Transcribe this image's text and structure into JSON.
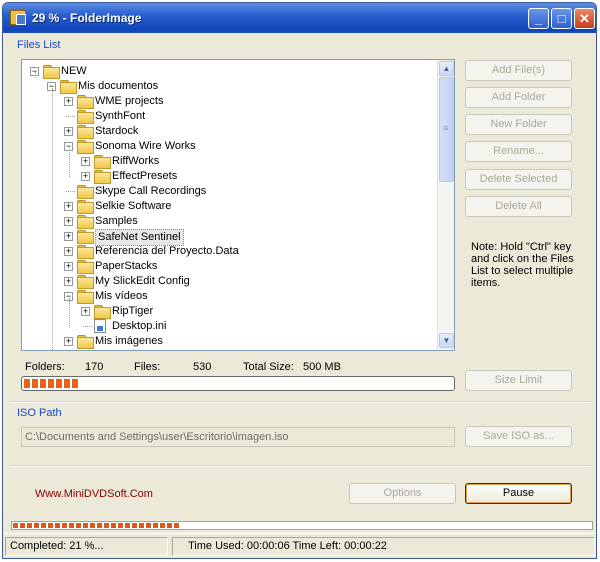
{
  "window": {
    "title": "29 % - FolderImage",
    "min_icon": "minimize-icon",
    "max_icon": "maximize-icon",
    "close_icon": "close-icon",
    "min_glyph": "_",
    "max_glyph": "□",
    "close_glyph": "✕"
  },
  "files_list": {
    "label": "Files List",
    "tree": [
      {
        "label": "NEW",
        "expander": "−"
      },
      {
        "label": "Mis documentos",
        "expander": "−"
      },
      {
        "label": "WME projects",
        "expander": "+"
      },
      {
        "label": "SynthFont",
        "expander": ""
      },
      {
        "label": "Stardock",
        "expander": "+"
      },
      {
        "label": "Sonoma Wire Works",
        "expander": "−"
      },
      {
        "label": "RiffWorks",
        "expander": "+"
      },
      {
        "label": "EffectPresets",
        "expander": "+"
      },
      {
        "label": "Skype Call Recordings",
        "expander": ""
      },
      {
        "label": "Selkie Software",
        "expander": "+"
      },
      {
        "label": "Samples",
        "expander": "+"
      },
      {
        "label": "SafeNet Sentinel",
        "expander": "+"
      },
      {
        "label": "Referencia del Proyecto.Data",
        "expander": "+"
      },
      {
        "label": "PaperStacks",
        "expander": "+"
      },
      {
        "label": "My SlickEdit Config",
        "expander": "+"
      },
      {
        "label": "Mis vídeos",
        "expander": "−"
      },
      {
        "label": "RipTiger",
        "expander": "+"
      },
      {
        "label": "Desktop.ini",
        "expander": ""
      },
      {
        "label": "Mis imágenes",
        "expander": "+"
      }
    ],
    "scroll_up": "▲",
    "scroll_down": "▼"
  },
  "buttons": {
    "add_files": "Add File(s)",
    "add_folder": "Add Folder",
    "new_folder": "New Folder",
    "rename": "Rename...",
    "delete_selected": "Delete Selected",
    "delete_all": "Delete All",
    "size_limit": "Size Limit",
    "save_iso": "Save ISO as...",
    "options": "Options",
    "pause": "Pause"
  },
  "note": "Note: Hold \"Ctrl\" key and click on the Files List to select multiple items.",
  "stats": {
    "folders_label": "Folders:",
    "folders": "170",
    "files_label": "Files:",
    "files": "530",
    "total_label": "Total Size:",
    "total": "500 MB",
    "size_progress": 0.13
  },
  "iso": {
    "label": "ISO Path",
    "path": "C:\\Documents and Settings\\user\\Escritorio\\imagen.iso"
  },
  "link": "Www.MiniDVDSoft.Com",
  "overall_progress": 0.29,
  "status": {
    "completed": "Completed: 21 %...",
    "time": "Time Used: 00:00:06  Time Left: 00:00:22"
  }
}
